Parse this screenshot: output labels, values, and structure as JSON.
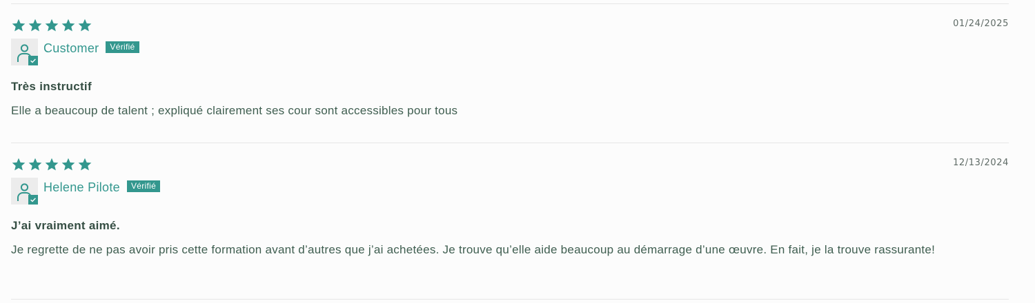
{
  "accent_color": "#33978e",
  "text_color": "#3f5e50",
  "reviews": [
    {
      "rating": 5,
      "max_rating": 5,
      "date": "01/24/2025",
      "author": "Customer",
      "verified_label": "Vérifié",
      "avatar_icon": "user-icon",
      "title": "Très instructif",
      "body": "Elle a beaucoup de talent ; expliqué clairement ses cour sont accessibles pour tous"
    },
    {
      "rating": 5,
      "max_rating": 5,
      "date": "12/13/2024",
      "author": "Helene Pilote",
      "verified_label": "Vérifié",
      "avatar_icon": "user-icon",
      "title": "J’ai vraiment aimé.",
      "body": "Je regrette de ne pas avoir pris cette formation avant d’autres que j’ai achetées. Je trouve qu’elle aide beaucoup au démarrage d’une œuvre. En fait, je la trouve rassurante!"
    }
  ]
}
